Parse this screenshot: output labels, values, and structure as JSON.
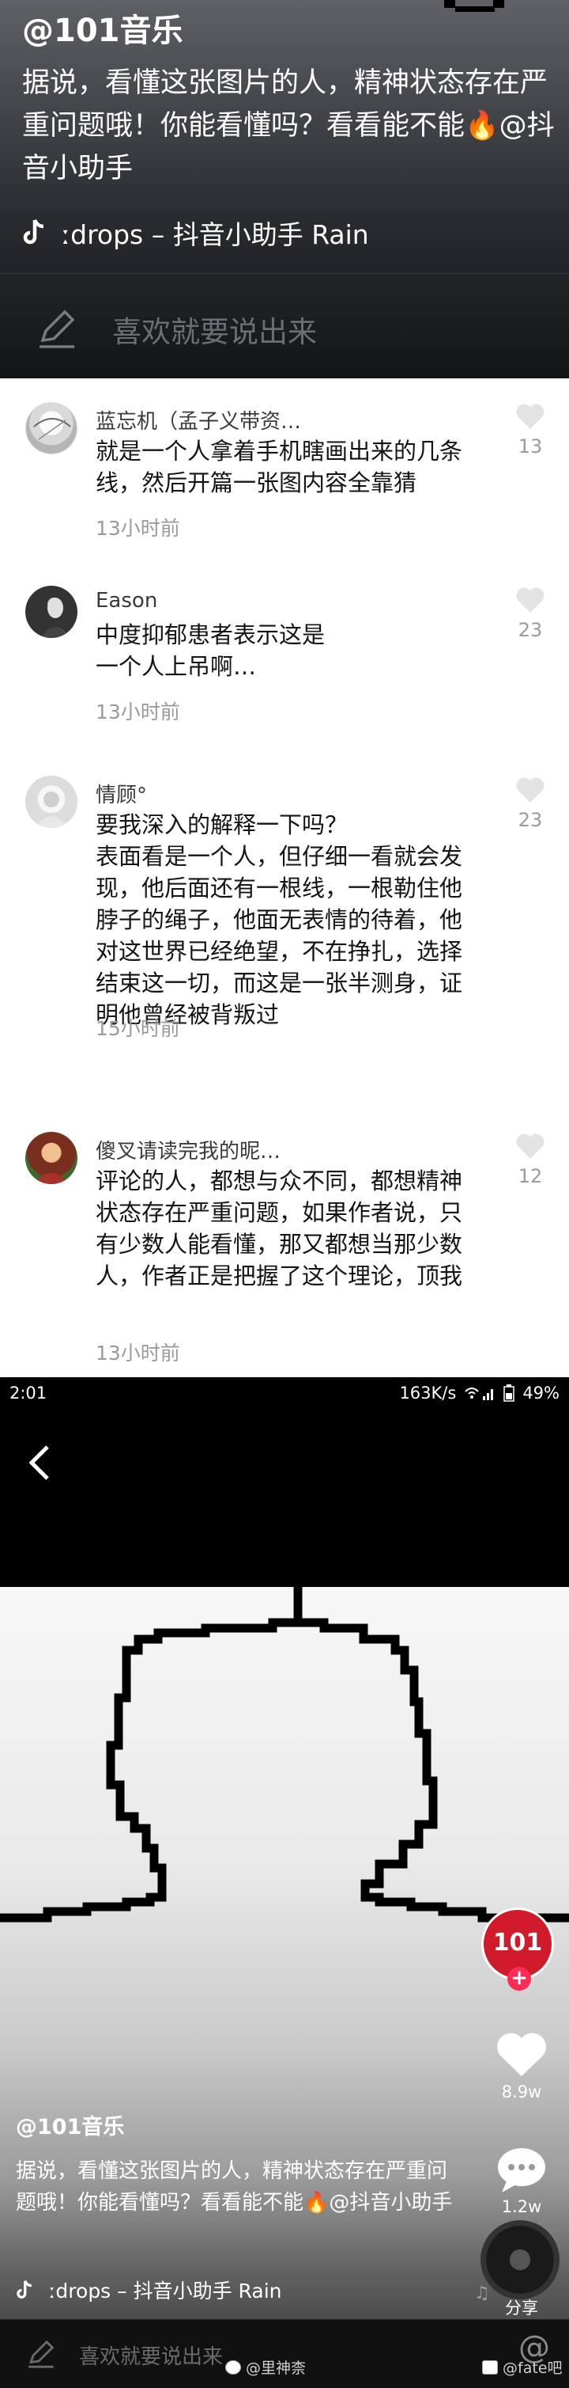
{
  "top_video": {
    "author": "@101音乐",
    "caption": "据说，看懂这张图片的人，精神状态存在严重问题哦！你能看懂吗？看看能不能🔥@抖音小助手",
    "music": "ːdrops – 抖音小助手   Rain",
    "input_hint": "喜欢就要说出来"
  },
  "comments": [
    {
      "username": "蓝忘机（孟子义带资…",
      "text": "就是一个人拿着手机瞎画出来的几条线，然后开篇一张图内容全靠猜",
      "time": "13小时前",
      "likes": "13"
    },
    {
      "username": "Eason",
      "text": "中度抑郁患者表示这是一个人上吊啊…",
      "time": "13小时前",
      "likes": "23"
    },
    {
      "username": "情顾°",
      "text": "要我深入的解释一下吗？\n表面看是一个人，但仔细一看就会发现，他后面还有一根线，一根勒住他脖子的绳子，他面无表情的待着，他对这世界已经绝望，不在挣扎，选择结束这一切，而这是一张半测身，证明他曾经被背叛过",
      "time": "15小时前",
      "likes": "23"
    },
    {
      "username": "傻叉请读完我的昵…",
      "text": "评论的人，都想与众不同，都想精神状态存在严重问题，如果作者说，只有少数人能看懂，那又都想当那少数人，作者正是把握了这个理论，顶我",
      "time": "13小时前",
      "likes": "12"
    }
  ],
  "phone": {
    "status": {
      "time": "2:01",
      "speed": "163K/s",
      "battery": "49%"
    },
    "profile_label": "101",
    "likes": "8.9w",
    "comments_count": "1.2w",
    "share_label": "分享",
    "author": "@101音乐",
    "caption": "据说，看懂这张图片的人，精神状态存在严重问题哦！你能看懂吗？看看能不能🔥@抖音小助手",
    "music": "ːdrops – 抖音小助手   Rain",
    "input_hint": "喜欢就要说出来",
    "watermark_left": "@里神柰",
    "watermark_right": "@fate吧"
  },
  "colors": {
    "like_red": "#fe2c55",
    "profile_red": "#d11a2a"
  }
}
